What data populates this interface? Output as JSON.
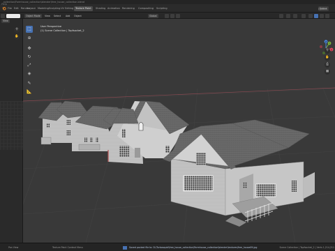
{
  "window": {
    "title_path": "_collection\\Farmhouse_collection\\blender\\free_house_collection.blend"
  },
  "topbar": {
    "menus": [
      "File",
      "Edit",
      "Render",
      "Window",
      "Help"
    ],
    "tabs": [
      "Layout",
      "Modeling",
      "Sculpting",
      "UV Editing",
      "Texture Paint",
      "Shading",
      "Animation",
      "Rendering",
      "Compositing",
      "Scripting"
    ],
    "active_tab": "Texture Paint",
    "scene_label": "Scene",
    "options_label": "Options"
  },
  "editor_header": {
    "mode": "Object Mode",
    "menus": [
      "View",
      "Select",
      "Add",
      "Object"
    ],
    "orientation": "Global",
    "left_panel_label": "View"
  },
  "viewport": {
    "view_name": "User Perspective",
    "collection_info": "(1) Scene Collection | Topfsocket_2",
    "tools": [
      "select-box-icon",
      "cursor-icon",
      "move-icon",
      "rotate-icon",
      "scale-icon",
      "transform-icon",
      "annotate-icon",
      "measure-icon"
    ],
    "gizmo_axes": [
      "X",
      "Y",
      "Z"
    ]
  },
  "statusbar": {
    "left_action": "Pan View",
    "mid_action": "Texture Paint Context Menu",
    "message": "Saved packed file to: D:\\Turbosquid\\free_house_collection\\Farmhouse_collection\\blender\\textures\\free_house09.jpg",
    "scene_info": "Scene Collection | Topfsocket_2 | Verts 1,214,211"
  },
  "colors": {
    "accent": "#4772b3",
    "background": "#393939",
    "header": "#2b2b2b",
    "axis_x": "#e0485e",
    "axis_y": "#7ab33c",
    "axis_z": "#4a85d8"
  }
}
